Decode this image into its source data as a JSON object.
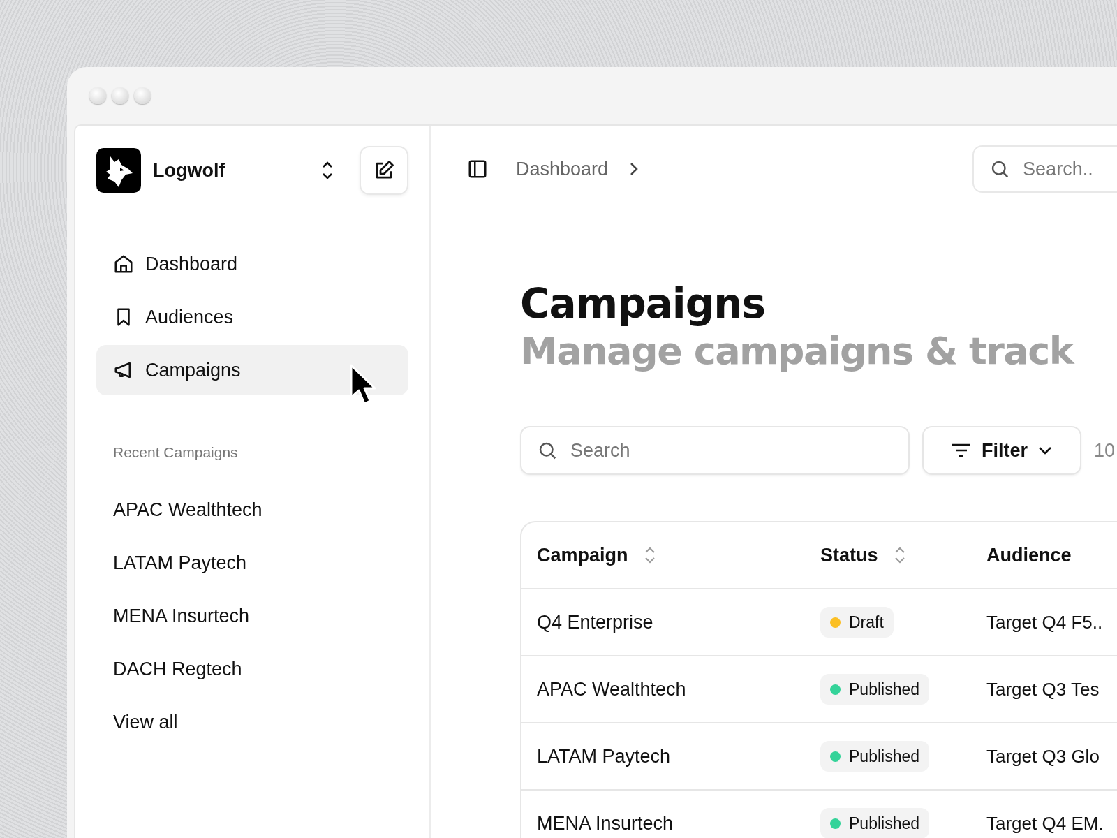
{
  "workspace": {
    "name": "Logwolf"
  },
  "nav": [
    {
      "label": "Dashboard",
      "kind": "home",
      "selected": false
    },
    {
      "label": "Audiences",
      "kind": "bookmark",
      "selected": false
    },
    {
      "label": "Campaigns",
      "kind": "megaphone",
      "selected": true
    }
  ],
  "recent": {
    "heading": "Recent Campaigns",
    "items": [
      "APAC Wealthtech",
      "LATAM Paytech",
      "MENA Insurtech",
      "DACH Regtech"
    ],
    "view_all": "View all"
  },
  "topbar": {
    "breadcrumb": "Dashboard",
    "search": {
      "placeholder": "Search.."
    }
  },
  "header": {
    "title": "Campaigns",
    "subtitle": "Manage campaigns & track"
  },
  "toolbar": {
    "search": {
      "placeholder": "Search"
    },
    "filter": "Filter",
    "column_3": "10"
  },
  "table": {
    "columns": [
      {
        "label": "Campaign",
        "sortable": true
      },
      {
        "label": "Status",
        "sortable": true
      },
      {
        "label": "Audience",
        "sortable": false
      }
    ],
    "rows": [
      {
        "campaign": "Q4 Enterprise",
        "status": "Draft",
        "color": "#fbbf24",
        "audience": "Target Q4 F5.."
      },
      {
        "campaign": "APAC Wealthtech",
        "status": "Published",
        "color": "#34d399",
        "audience": "Target Q3 Tes"
      },
      {
        "campaign": "LATAM Paytech",
        "status": "Published",
        "color": "#34d399",
        "audience": "Target Q3 Glo"
      },
      {
        "campaign": "MENA Insurtech",
        "status": "Published",
        "color": "#34d399",
        "audience": "Target Q4 EM."
      }
    ]
  }
}
